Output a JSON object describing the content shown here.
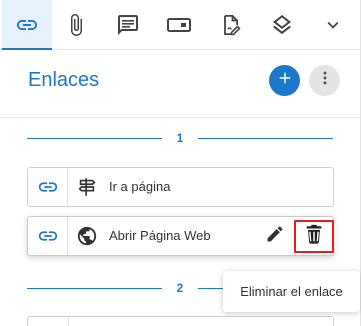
{
  "toolbar": {
    "tabs": [
      {
        "name": "links",
        "icon": "link-icon",
        "active": true
      },
      {
        "name": "attachments",
        "icon": "paperclip-icon",
        "active": false
      },
      {
        "name": "comments",
        "icon": "comment-icon",
        "active": false
      },
      {
        "name": "fields",
        "icon": "form-field-icon",
        "active": false
      },
      {
        "name": "signatures",
        "icon": "document-signature-icon",
        "active": false
      },
      {
        "name": "layers",
        "icon": "layers-icon",
        "active": false
      },
      {
        "name": "more",
        "icon": "chevron-down-icon",
        "active": false
      }
    ]
  },
  "header": {
    "title": "Enlaces",
    "add_icon": "plus-icon",
    "more_icon": "more-vertical-icon"
  },
  "pages": [
    {
      "number": "1",
      "links": [
        {
          "label": "Ir a página",
          "type_icon": "signpost-icon",
          "selected": false
        },
        {
          "label": "Abrir Página Web",
          "type_icon": "globe-icon",
          "selected": true
        }
      ]
    },
    {
      "number": "2",
      "links": []
    }
  ],
  "tooltip": {
    "text": "Eliminar el enlace"
  },
  "colors": {
    "accent": "#1c78c9",
    "delete_highlight": "#e02020"
  }
}
